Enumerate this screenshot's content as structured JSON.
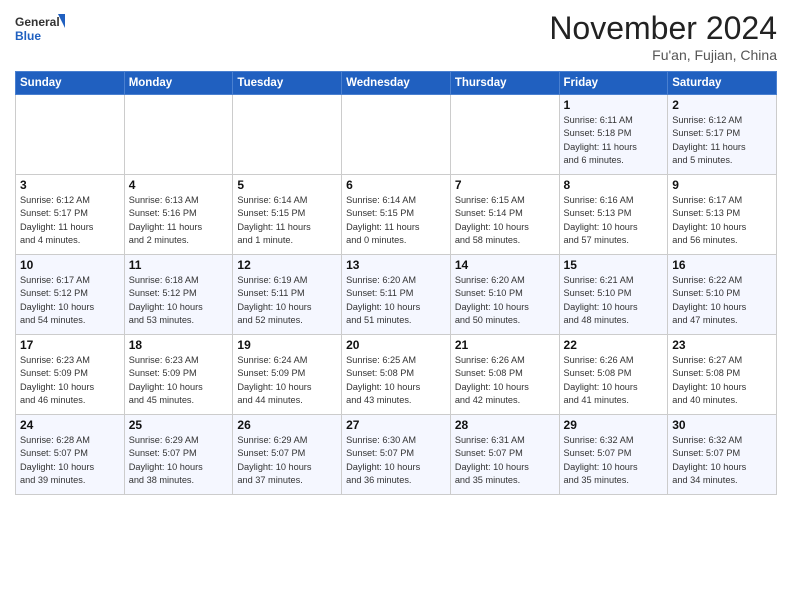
{
  "header": {
    "logo_general": "General",
    "logo_blue": "Blue",
    "month_title": "November 2024",
    "location": "Fu'an, Fujian, China"
  },
  "weekdays": [
    "Sunday",
    "Monday",
    "Tuesday",
    "Wednesday",
    "Thursday",
    "Friday",
    "Saturday"
  ],
  "weeks": [
    [
      {
        "day": "",
        "info": ""
      },
      {
        "day": "",
        "info": ""
      },
      {
        "day": "",
        "info": ""
      },
      {
        "day": "",
        "info": ""
      },
      {
        "day": "",
        "info": ""
      },
      {
        "day": "1",
        "info": "Sunrise: 6:11 AM\nSunset: 5:18 PM\nDaylight: 11 hours\nand 6 minutes."
      },
      {
        "day": "2",
        "info": "Sunrise: 6:12 AM\nSunset: 5:17 PM\nDaylight: 11 hours\nand 5 minutes."
      }
    ],
    [
      {
        "day": "3",
        "info": "Sunrise: 6:12 AM\nSunset: 5:17 PM\nDaylight: 11 hours\nand 4 minutes."
      },
      {
        "day": "4",
        "info": "Sunrise: 6:13 AM\nSunset: 5:16 PM\nDaylight: 11 hours\nand 2 minutes."
      },
      {
        "day": "5",
        "info": "Sunrise: 6:14 AM\nSunset: 5:15 PM\nDaylight: 11 hours\nand 1 minute."
      },
      {
        "day": "6",
        "info": "Sunrise: 6:14 AM\nSunset: 5:15 PM\nDaylight: 11 hours\nand 0 minutes."
      },
      {
        "day": "7",
        "info": "Sunrise: 6:15 AM\nSunset: 5:14 PM\nDaylight: 10 hours\nand 58 minutes."
      },
      {
        "day": "8",
        "info": "Sunrise: 6:16 AM\nSunset: 5:13 PM\nDaylight: 10 hours\nand 57 minutes."
      },
      {
        "day": "9",
        "info": "Sunrise: 6:17 AM\nSunset: 5:13 PM\nDaylight: 10 hours\nand 56 minutes."
      }
    ],
    [
      {
        "day": "10",
        "info": "Sunrise: 6:17 AM\nSunset: 5:12 PM\nDaylight: 10 hours\nand 54 minutes."
      },
      {
        "day": "11",
        "info": "Sunrise: 6:18 AM\nSunset: 5:12 PM\nDaylight: 10 hours\nand 53 minutes."
      },
      {
        "day": "12",
        "info": "Sunrise: 6:19 AM\nSunset: 5:11 PM\nDaylight: 10 hours\nand 52 minutes."
      },
      {
        "day": "13",
        "info": "Sunrise: 6:20 AM\nSunset: 5:11 PM\nDaylight: 10 hours\nand 51 minutes."
      },
      {
        "day": "14",
        "info": "Sunrise: 6:20 AM\nSunset: 5:10 PM\nDaylight: 10 hours\nand 50 minutes."
      },
      {
        "day": "15",
        "info": "Sunrise: 6:21 AM\nSunset: 5:10 PM\nDaylight: 10 hours\nand 48 minutes."
      },
      {
        "day": "16",
        "info": "Sunrise: 6:22 AM\nSunset: 5:10 PM\nDaylight: 10 hours\nand 47 minutes."
      }
    ],
    [
      {
        "day": "17",
        "info": "Sunrise: 6:23 AM\nSunset: 5:09 PM\nDaylight: 10 hours\nand 46 minutes."
      },
      {
        "day": "18",
        "info": "Sunrise: 6:23 AM\nSunset: 5:09 PM\nDaylight: 10 hours\nand 45 minutes."
      },
      {
        "day": "19",
        "info": "Sunrise: 6:24 AM\nSunset: 5:09 PM\nDaylight: 10 hours\nand 44 minutes."
      },
      {
        "day": "20",
        "info": "Sunrise: 6:25 AM\nSunset: 5:08 PM\nDaylight: 10 hours\nand 43 minutes."
      },
      {
        "day": "21",
        "info": "Sunrise: 6:26 AM\nSunset: 5:08 PM\nDaylight: 10 hours\nand 42 minutes."
      },
      {
        "day": "22",
        "info": "Sunrise: 6:26 AM\nSunset: 5:08 PM\nDaylight: 10 hours\nand 41 minutes."
      },
      {
        "day": "23",
        "info": "Sunrise: 6:27 AM\nSunset: 5:08 PM\nDaylight: 10 hours\nand 40 minutes."
      }
    ],
    [
      {
        "day": "24",
        "info": "Sunrise: 6:28 AM\nSunset: 5:07 PM\nDaylight: 10 hours\nand 39 minutes."
      },
      {
        "day": "25",
        "info": "Sunrise: 6:29 AM\nSunset: 5:07 PM\nDaylight: 10 hours\nand 38 minutes."
      },
      {
        "day": "26",
        "info": "Sunrise: 6:29 AM\nSunset: 5:07 PM\nDaylight: 10 hours\nand 37 minutes."
      },
      {
        "day": "27",
        "info": "Sunrise: 6:30 AM\nSunset: 5:07 PM\nDaylight: 10 hours\nand 36 minutes."
      },
      {
        "day": "28",
        "info": "Sunrise: 6:31 AM\nSunset: 5:07 PM\nDaylight: 10 hours\nand 35 minutes."
      },
      {
        "day": "29",
        "info": "Sunrise: 6:32 AM\nSunset: 5:07 PM\nDaylight: 10 hours\nand 35 minutes."
      },
      {
        "day": "30",
        "info": "Sunrise: 6:32 AM\nSunset: 5:07 PM\nDaylight: 10 hours\nand 34 minutes."
      }
    ]
  ]
}
